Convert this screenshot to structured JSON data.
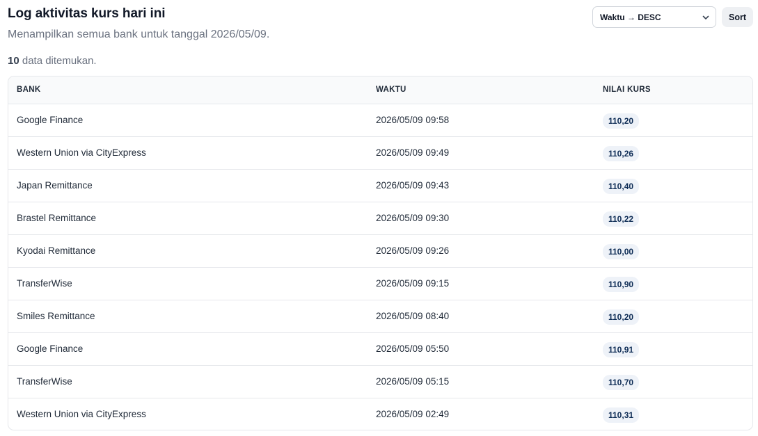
{
  "header": {
    "title": "Log aktivitas kurs hari ini",
    "subtitle": "Menampilkan semua bank untuk tanggal 2026/05/09.",
    "count_value": "10",
    "count_suffix": " data ditemukan."
  },
  "controls": {
    "sort_select_value": "Waktu → DESC",
    "sort_button_label": "Sort"
  },
  "table": {
    "columns": [
      "BANK",
      "WAKTU",
      "NILAI KURS"
    ],
    "rows": [
      {
        "bank": "Google Finance",
        "time": "2026/05/09 09:58",
        "rate": "110,20"
      },
      {
        "bank": "Western Union via CityExpress",
        "time": "2026/05/09 09:49",
        "rate": "110,26"
      },
      {
        "bank": "Japan Remittance",
        "time": "2026/05/09 09:43",
        "rate": "110,40"
      },
      {
        "bank": "Brastel Remittance",
        "time": "2026/05/09 09:30",
        "rate": "110,22"
      },
      {
        "bank": "Kyodai Remittance",
        "time": "2026/05/09 09:26",
        "rate": "110,00"
      },
      {
        "bank": "TransferWise",
        "time": "2026/05/09 09:15",
        "rate": "110,90"
      },
      {
        "bank": "Smiles Remittance",
        "time": "2026/05/09 08:40",
        "rate": "110,20"
      },
      {
        "bank": "Google Finance",
        "time": "2026/05/09 05:50",
        "rate": "110,91"
      },
      {
        "bank": "TransferWise",
        "time": "2026/05/09 05:15",
        "rate": "110,70"
      },
      {
        "bank": "Western Union via CityExpress",
        "time": "2026/05/09 02:49",
        "rate": "110,31"
      }
    ]
  },
  "icons": {
    "select_chevron": "chevron-down-icon"
  },
  "colors": {
    "badge_bg": "#eef2f8",
    "badge_text": "#0f2d56",
    "muted_text": "#6b7280"
  }
}
